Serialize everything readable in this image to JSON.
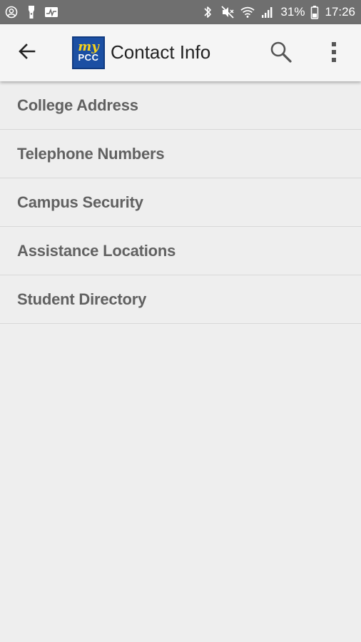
{
  "status_bar": {
    "battery_percent": "31%",
    "time": "17:26",
    "left_icons": [
      "account-circle-icon",
      "flashlight-icon",
      "activity-icon"
    ],
    "right_icons": [
      "bluetooth-icon",
      "mute-icon",
      "wifi-icon",
      "signal-icon",
      "battery-icon"
    ]
  },
  "app_bar": {
    "title": "Contact Info",
    "logo": {
      "top_text": "my",
      "bottom_text": "PCC"
    },
    "back_icon": "arrow-back-icon",
    "search_icon": "search-icon",
    "menu_icon": "more-vert-icon"
  },
  "list": {
    "items": [
      {
        "label": "College Address"
      },
      {
        "label": "Telephone Numbers"
      },
      {
        "label": "Campus Security"
      },
      {
        "label": "Assistance Locations"
      },
      {
        "label": "Student Directory"
      }
    ]
  },
  "colors": {
    "status_bar_bg": "#6f6f6f",
    "app_bar_bg": "#f5f5f5",
    "page_bg": "#eeeeee",
    "logo_bg": "#1b4fa3",
    "logo_accent": "#f7d21a",
    "list_text": "#616161"
  }
}
